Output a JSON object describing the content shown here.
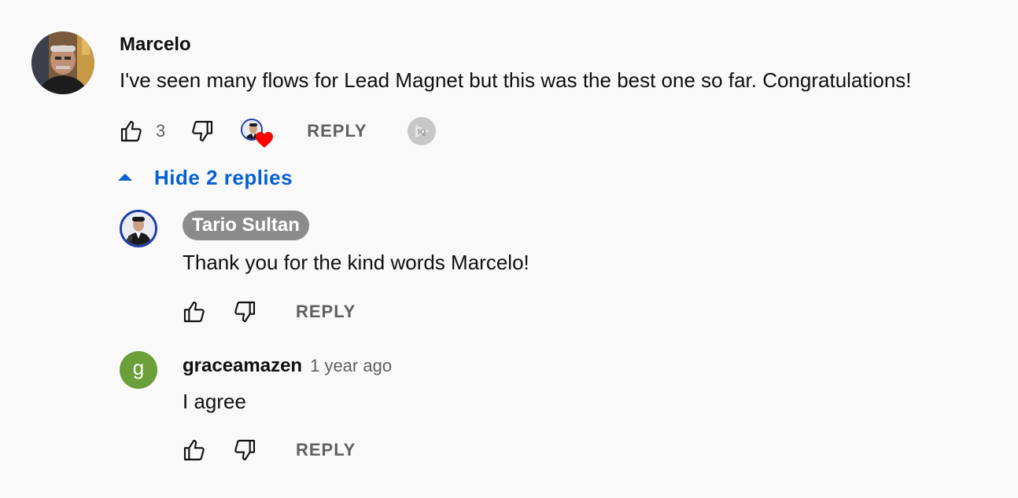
{
  "comment": {
    "author": "Marcelo",
    "text": "I've seen many flows for Lead Magnet but this was the best one so far. Congratulations!",
    "likes": "3",
    "reply_label": "REPLY",
    "avatar_icon": "user-photo-marcelo",
    "hearted_by_creator": true,
    "heart_color": "#ff0000"
  },
  "toggle_replies": {
    "label": "Hide 2 replies",
    "icon": "caret-up-icon",
    "color": "#065fd4"
  },
  "replies": [
    {
      "author": "Tario Sultan",
      "is_creator": true,
      "text": "Thank you for the kind words Marcelo!",
      "reply_label": "REPLY",
      "avatar_icon": "user-photo-tario"
    },
    {
      "author": "graceamazen",
      "timestamp": "1 year ago",
      "text": "I agree",
      "reply_label": "REPLY",
      "avatar_letter": "g",
      "avatar_color": "#6a9f3a"
    }
  ]
}
